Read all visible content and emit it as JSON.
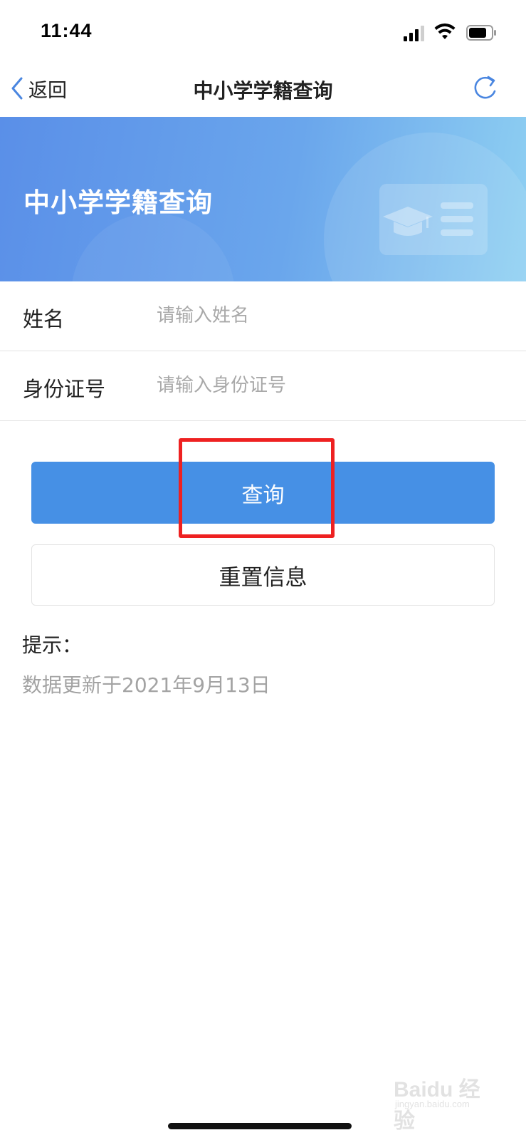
{
  "status_bar": {
    "time": "11:44",
    "icons": [
      "cellular-signal-icon",
      "wifi-icon",
      "battery-icon"
    ]
  },
  "nav": {
    "back_label": "返回",
    "title": "中小学学籍查询",
    "refresh_icon": "refresh-icon"
  },
  "banner": {
    "title": "中小学学籍查询",
    "illustration_icon": "student-id-card-icon"
  },
  "form": {
    "name": {
      "label": "姓名",
      "placeholder": "请输入姓名",
      "value": ""
    },
    "id_number": {
      "label": "身份证号",
      "placeholder": "请输入身份证号",
      "value": ""
    }
  },
  "buttons": {
    "query_label": "查询",
    "reset_label": "重置信息"
  },
  "tips": {
    "title": "提示：",
    "text": "数据更新于2021年9月13日"
  },
  "watermark": {
    "main": "Baidu 经验",
    "sub": "jingyan.baidu.com"
  },
  "colors": {
    "primary_button": "#4690e5",
    "banner_gradient_start": "#5a8fe8",
    "banner_gradient_end": "#8fd0f2",
    "highlight_box": "#ee2121",
    "nav_accent": "#4a86e0"
  }
}
